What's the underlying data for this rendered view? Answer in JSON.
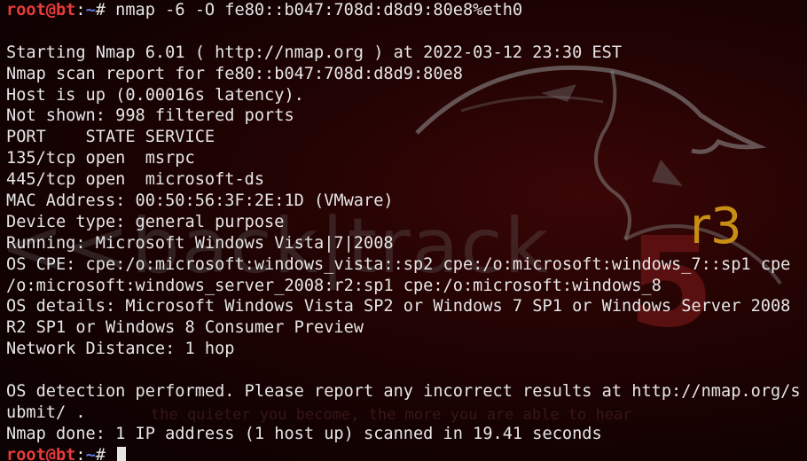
{
  "prompt": {
    "user_host": "root@bt",
    "separator": ":",
    "path": "~",
    "symbol": "# "
  },
  "command": "nmap -6 -O fe80::b047:708d:d8d9:80e8%eth0",
  "output": [
    "",
    "Starting Nmap 6.01 ( http://nmap.org ) at 2022-03-12 23:30 EST",
    "Nmap scan report for fe80::b047:708d:d8d9:80e8",
    "Host is up (0.00016s latency).",
    "Not shown: 998 filtered ports",
    "PORT    STATE SERVICE",
    "135/tcp open  msrpc",
    "445/tcp open  microsoft-ds",
    "MAC Address: 00:50:56:3F:2E:1D (VMware)",
    "Device type: general purpose",
    "Running: Microsoft Windows Vista|7|2008",
    "OS CPE: cpe:/o:microsoft:windows_vista::sp2 cpe:/o:microsoft:windows_7::sp1 cpe",
    "/o:microsoft:windows_server_2008:r2:sp1 cpe:/o:microsoft:windows_8",
    "OS details: Microsoft Windows Vista SP2 or Windows 7 SP1 or Windows Server 2008",
    "R2 SP1 or Windows 8 Consumer Preview",
    "Network Distance: 1 hop",
    "",
    "OS detection performed. Please report any incorrect results at http://nmap.org/s",
    "ubmit/ .",
    "Nmap done: 1 IP address (1 host up) scanned in 19.41 seconds"
  ],
  "wallpaper": {
    "brand": "<<back|track",
    "version": "5",
    "release": "r3",
    "slogan": "the quieter you become, the more you are able to hear"
  },
  "colors": {
    "prompt_user": "#e83c3c",
    "prompt_path": "#5a7ad8",
    "text": "#e6e6e6",
    "background": "#1a0303",
    "release_accent": "#c98f14"
  }
}
